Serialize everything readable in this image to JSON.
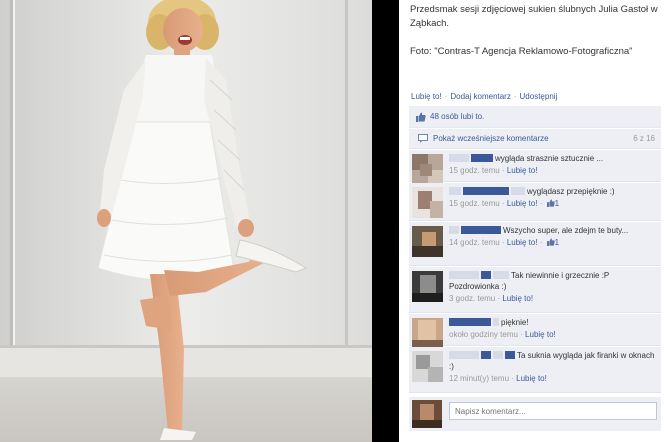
{
  "caption": {
    "line1": "Przedsmak sesji zdjęciowej sukien ślubnych Julia Gastoł w Ząbkach.",
    "line2": "Foto: \"Contras-T Agencja Reklamowo-Fotograficzna\""
  },
  "actions": {
    "like": "Lubię to!",
    "comment": "Dodaj komentarz",
    "share": "Udostępnij"
  },
  "likes": {
    "text": "48 osób lubi to."
  },
  "previous": {
    "label": "Pokaż wcześniejsze komentarze",
    "count": "6 z 16"
  },
  "comments": [
    {
      "text": "wygląda strasznie sztucznie ...",
      "time": "15 godz. temu",
      "like": "Lubię to!",
      "likes": ""
    },
    {
      "text": "wyglądasz przepięknie :)",
      "time": "15 godz. temu",
      "like": "Lubię to!",
      "likes": "1"
    },
    {
      "text": "Wszycho super, ale zdejm te buty...",
      "time": "14 godz. temu",
      "like": "Lubię to!",
      "likes": "1"
    },
    {
      "text": "Tak niewinnie i grzecznie :P Pozdrowionka :)",
      "time": "3 godz. temu",
      "like": "Lubię to!",
      "likes": ""
    },
    {
      "text": "pięknie!",
      "time": "około godziny temu",
      "like": "Lubię to!",
      "likes": ""
    },
    {
      "text": "Ta suknia wygląda jak firanki w oknach :)",
      "time": "12 minut(y) temu",
      "like": "Lubię to!",
      "likes": ""
    }
  ],
  "composer": {
    "placeholder": "Napisz komentarz..."
  },
  "colors": {
    "link": "#3b5998",
    "panel_bg": "#edeff4",
    "muted": "#999999"
  },
  "icons": [
    "thumbs-up-icon",
    "comment-bubble-icon"
  ]
}
